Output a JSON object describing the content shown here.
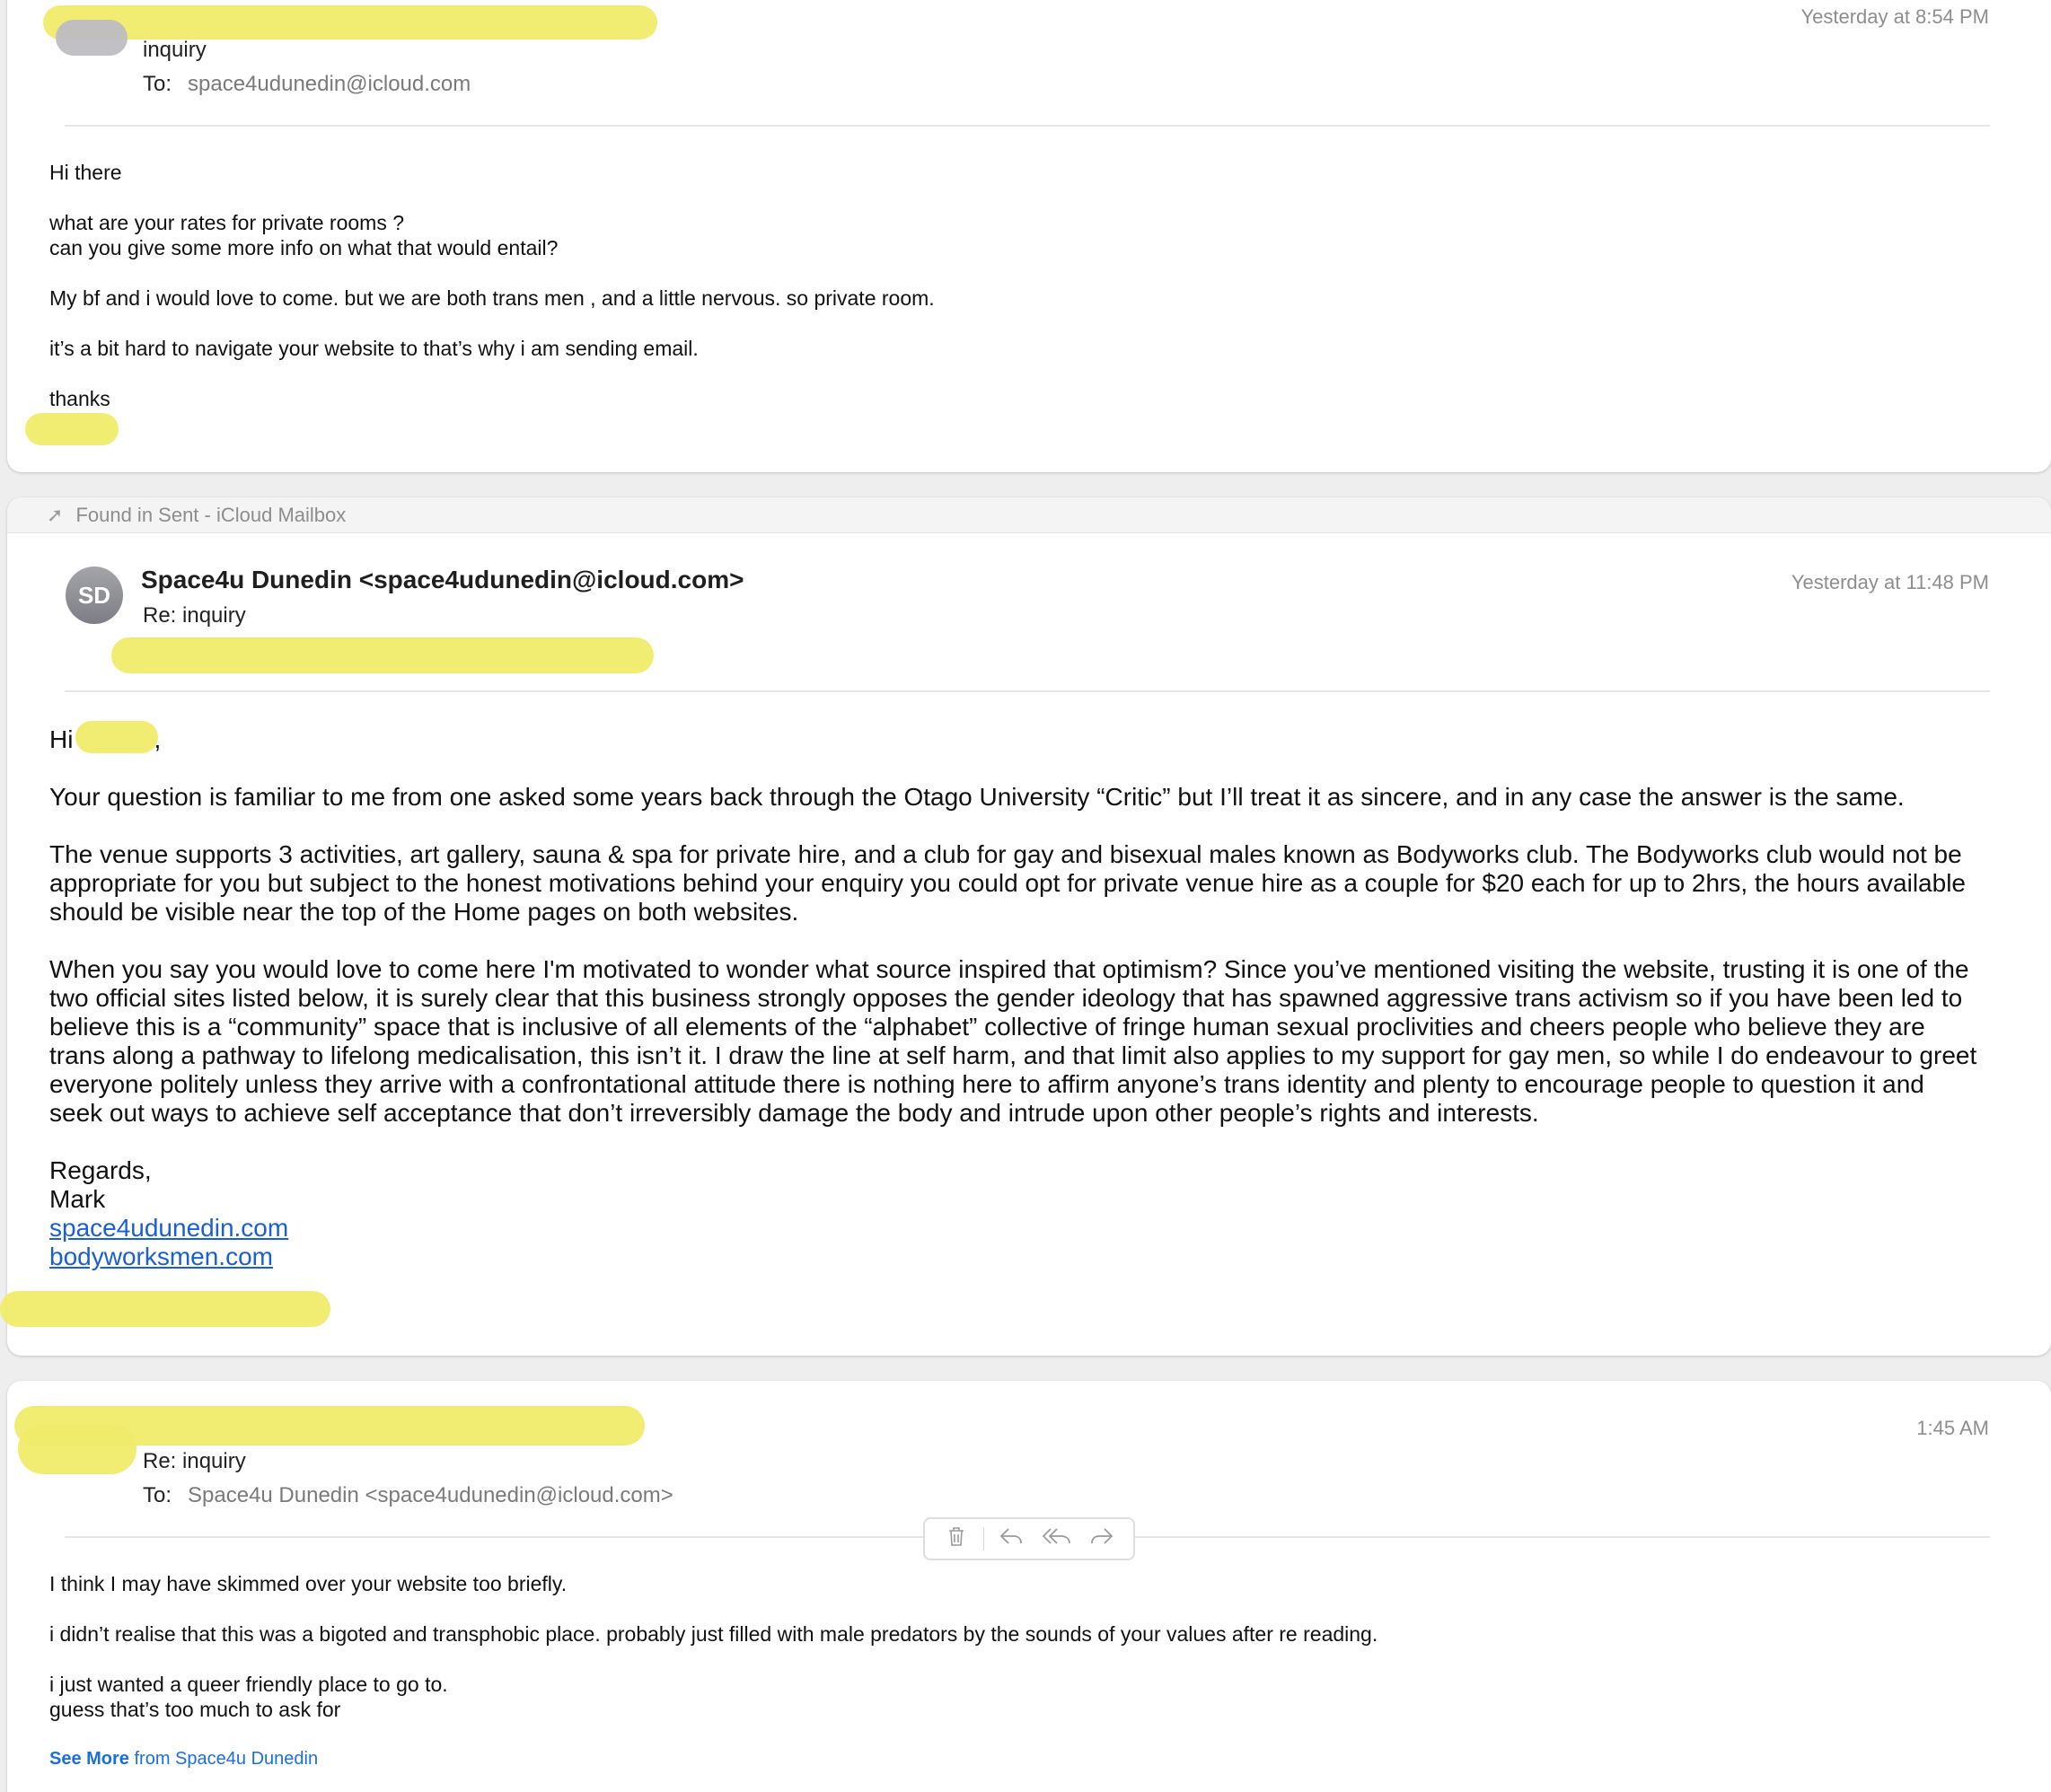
{
  "message1": {
    "subject": "inquiry",
    "to_label": "To:",
    "to_address": "space4udunedin@icloud.com",
    "timestamp": "Yesterday at 8:54 PM",
    "body": [
      "Hi there",
      "what are your rates for private rooms ?",
      "can you give some more info on what that would entail?",
      "My bf and i would love to come. but we are both trans men , and a little nervous. so private room.",
      "it’s a bit hard to navigate your website to that’s why i am sending email.",
      "thanks"
    ]
  },
  "message2": {
    "found_in": "Found in Sent - iCloud Mailbox",
    "avatar_initials": "SD",
    "sender": "Space4u Dunedin <space4udunedin@icloud.com>",
    "subject": "Re: inquiry",
    "timestamp": "Yesterday at 11:48 PM",
    "greeting": "Hi",
    "greeting_suffix": ",",
    "paragraph1": "Your question is familiar to me from one asked  some years back through the Otago University  “Critic” but I’ll treat it as sincere, and in any case the answer is the same.",
    "paragraph2_lines": [
      "The venue supports 3 activities, art gallery, sauna & spa for private hire, and a  club for gay and bisexual males known as  Bodyworks club. The Bodyworks club would not be",
      "appropriate for you but subject to the  honest motivations behind your enquiry you could opt for private venue hire as a couple for  $20 each for up to 2hrs, the hours available",
      "should be visible  near the top of the Home pages  on both websites."
    ],
    "paragraph3_lines": [
      "When you say you would love to come here I'm motivated to wonder what source inspired that optimism?  Since you’ve mentioned visiting the  website, trusting it is one of the",
      "two official sites listed below,  it is surely clear that this  business  strongly opposes the gender ideology that has spawned aggressive  trans activism so if you have been led to",
      "believe this is  a “community” space that is inclusive of all elements of the  “alphabet” collective of fringe human sexual proclivities  and cheers people who believe they are",
      "trans  along a pathway to lifelong medicalisation, this isn’t it. I draw the line at self harm, and that limit also applies to my support for gay men, so while I do endeavour to greet",
      "everyone  politely unless they arrive with a confrontational attitude  there is nothing here to affirm anyone’s trans identity and plenty to encourage people  to question it and",
      "seek out ways to achieve  self acceptance that don’t irreversibly  damage the body and intrude upon other people’s rights and interests."
    ],
    "signoff": "Regards,",
    "signature": "Mark",
    "link1": "space4udunedin.com",
    "link2": "bodyworksmen.com"
  },
  "message3": {
    "subject": "Re: inquiry",
    "to_label": "To:",
    "to_address": "Space4u Dunedin <space4udunedin@icloud.com>",
    "timestamp": "1:45 AM",
    "body": [
      "I think I may have skimmed over your website too briefly.",
      "i didn’t realise that this was a bigoted and transphobic place. probably just filled with male predators by the sounds of your values after re reading.",
      "i just wanted a queer friendly place to go to.",
      "guess that’s too much to ask for"
    ],
    "see_more_bold": "See More",
    "see_more_rest": " from Space4u Dunedin"
  },
  "toolbar": {
    "icons": [
      "trash-icon",
      "reply-icon",
      "reply-all-icon",
      "forward-icon"
    ]
  },
  "colors": {
    "redaction": "#f0eb6a",
    "link": "#1a5fd6",
    "see_more": "#1a6fe0"
  }
}
